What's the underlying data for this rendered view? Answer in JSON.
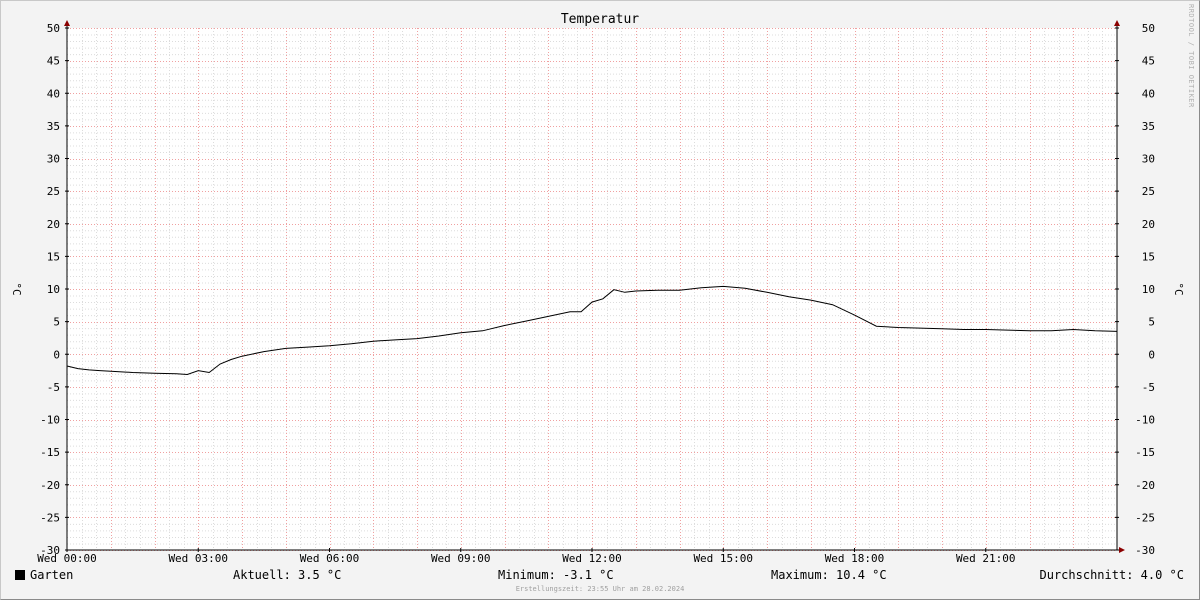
{
  "chart_data": {
    "type": "line",
    "title": "Temperatur",
    "ylabel": "°C",
    "ylim": [
      -30,
      50
    ],
    "ytick_step": 5,
    "y_ticks": [
      "50",
      "45",
      "40",
      "35",
      "30",
      "25",
      "20",
      "15",
      "10",
      "5",
      "0",
      "-5",
      "-10",
      "-15",
      "-20",
      "-25",
      "-30"
    ],
    "x_tick_labels": [
      "Wed 00:00",
      "Wed 03:00",
      "Wed 06:00",
      "Wed 09:00",
      "Wed 12:00",
      "Wed 15:00",
      "Wed 18:00",
      "Wed 21:00"
    ],
    "x_range_hours": [
      0,
      24
    ],
    "grid": true,
    "series": [
      {
        "name": "Garten",
        "color": "#000000",
        "x_hours": [
          0,
          0.25,
          0.5,
          0.75,
          1,
          1.5,
          2,
          2.5,
          2.75,
          3,
          3.25,
          3.5,
          3.75,
          4,
          4.5,
          5,
          5.5,
          6,
          6.5,
          7,
          7.5,
          8,
          8.5,
          9,
          9.5,
          10,
          10.5,
          11,
          11.5,
          11.75,
          12,
          12.25,
          12.5,
          12.75,
          13,
          13.5,
          14,
          14.5,
          15,
          15.5,
          16,
          16.5,
          17,
          17.5,
          18,
          18.5,
          19,
          19.5,
          20,
          20.5,
          21,
          21.5,
          22,
          22.5,
          23,
          23.5,
          24
        ],
        "values": [
          -1.8,
          -2.2,
          -2.4,
          -2.5,
          -2.6,
          -2.8,
          -2.9,
          -3.0,
          -3.1,
          -2.5,
          -2.8,
          -1.5,
          -0.8,
          -0.3,
          0.4,
          0.9,
          1.1,
          1.3,
          1.6,
          2.0,
          2.2,
          2.4,
          2.8,
          3.3,
          3.6,
          4.4,
          5.1,
          5.8,
          6.5,
          6.5,
          8.0,
          8.5,
          9.9,
          9.5,
          9.7,
          9.8,
          9.8,
          10.2,
          10.4,
          10.1,
          9.5,
          8.8,
          8.3,
          7.6,
          6.0,
          4.3,
          4.1,
          4.0,
          3.9,
          3.8,
          3.8,
          3.7,
          3.6,
          3.6,
          3.8,
          3.6,
          3.5
        ]
      }
    ]
  },
  "legend": {
    "series_name": "Garten",
    "current": "Aktuell: 3.5 °C",
    "minimum": "Minimum: -3.1 °C",
    "maximum": "Maximum: 10.4 °C",
    "average": "Durchschnitt: 4.0 °C"
  },
  "footer": "Erstellungszeit: 23:55 Uhr am 28.02.2024",
  "watermark": "RRDTOOL / TOBI OETIKER"
}
